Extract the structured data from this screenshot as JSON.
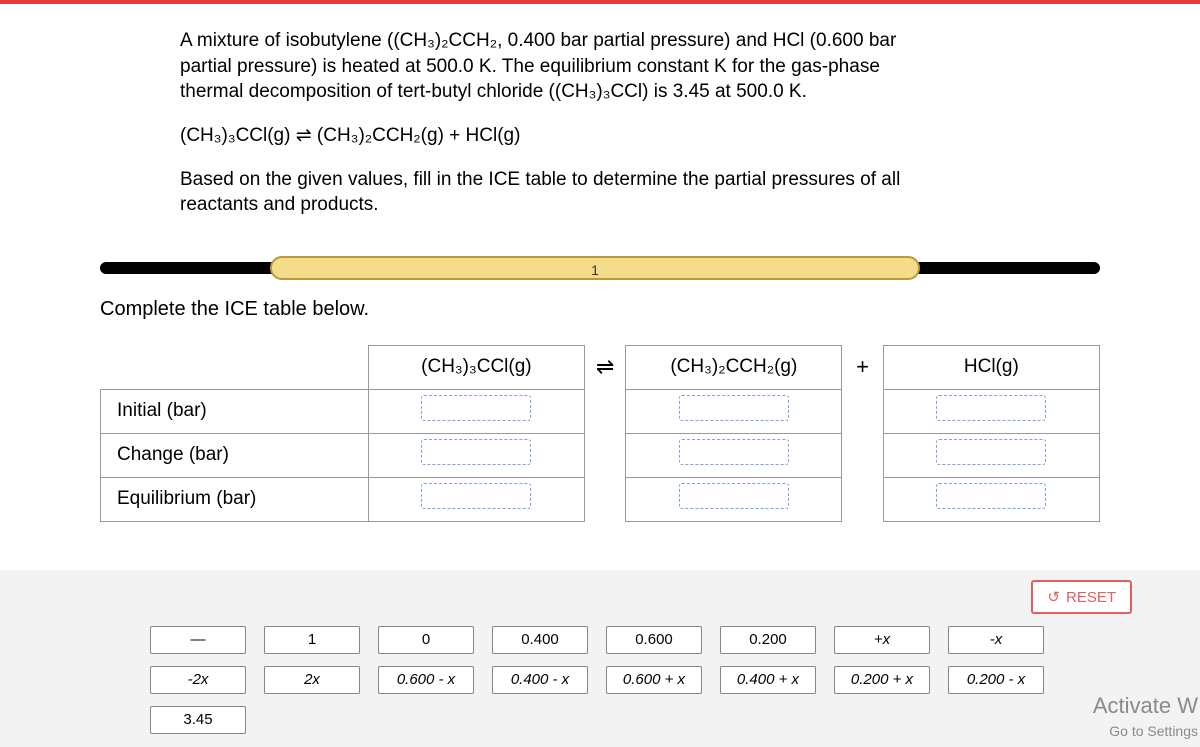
{
  "question": {
    "p1": "A mixture of isobutylene ((CH₃)₂CCH₂, 0.400 bar partial pressure) and HCl (0.600 bar partial pressure) is heated at 500.0 K. The equilibrium constant K for the gas-phase thermal decomposition of tert-butyl chloride ((CH₃)₃CCl) is 3.45 at 500.0 K.",
    "p2": "(CH₃)₃CCl(g) ⇌ (CH₃)₂CCH₂(g) + HCl(g)",
    "p3": "Based on the given values, fill in the ICE table to determine the partial pressures of all reactants and products."
  },
  "progress": {
    "step": "1"
  },
  "instruction": "Complete the ICE table below.",
  "table": {
    "header": {
      "c1": "(CH₃)₃CCl(g)",
      "s1": "⇌",
      "c2": "(CH₃)₂CCH₂(g)",
      "s2": "+",
      "c3": "HCl(g)"
    },
    "rows": [
      {
        "label": "Initial (bar)"
      },
      {
        "label": "Change (bar)"
      },
      {
        "label": "Equilibrium (bar)"
      }
    ]
  },
  "reset": "RESET",
  "tiles": {
    "row1": [
      "—",
      "1",
      "0",
      "0.400",
      "0.600",
      "0.200",
      "+x",
      "-x"
    ],
    "row2": [
      "-2x",
      "2x",
      "0.600 - x",
      "0.400 - x",
      "0.600 + x",
      "0.400 + x",
      "0.200 + x",
      "0.200 - x"
    ],
    "row3": [
      "3.45"
    ]
  },
  "watermark": {
    "l1": "Activate W",
    "l2": "Go to Settings"
  }
}
